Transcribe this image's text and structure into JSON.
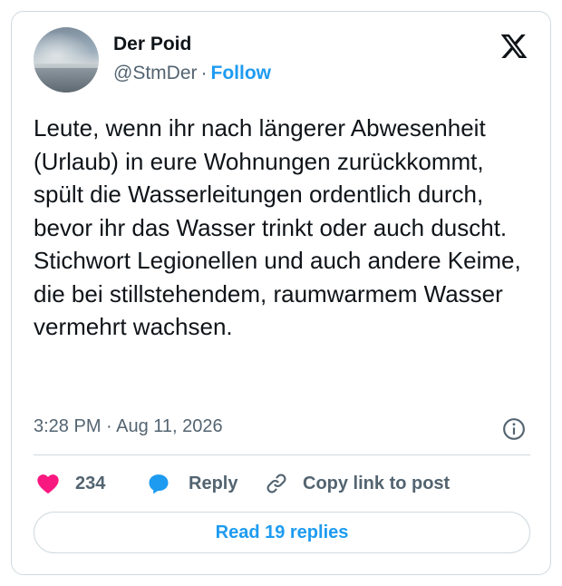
{
  "author": {
    "display_name": "Der Poid",
    "handle": "@StmDer",
    "separator": "·",
    "follow_label": "Follow"
  },
  "tweet": {
    "text": "Leute, wenn ihr nach längerer Abwesenheit (Urlaub) in eure Wohnungen zurückkommt, spült die Wasserleitungen ordentlich durch, bevor ihr das Wasser trinkt oder auch duscht. Stichwort Legionellen und auch andere Keime, die bei stillstehendem, raumwarmem Wasser vermehrt wachsen.",
    "timestamp": "3:28 PM · Aug 11, 2026"
  },
  "actions": {
    "like_count": "234",
    "reply_label": "Reply",
    "copy_label": "Copy link to post"
  },
  "read_replies_label": "Read 19 replies",
  "icons": {
    "logo": "x-logo-icon",
    "info": "info-icon",
    "like": "heart-icon",
    "reply": "speech-bubble-icon",
    "copy": "link-icon"
  },
  "colors": {
    "accent": "#1d9bf0",
    "like": "#f91880",
    "text": "#0f1419",
    "muted": "#536471",
    "border": "#cfd9de"
  }
}
